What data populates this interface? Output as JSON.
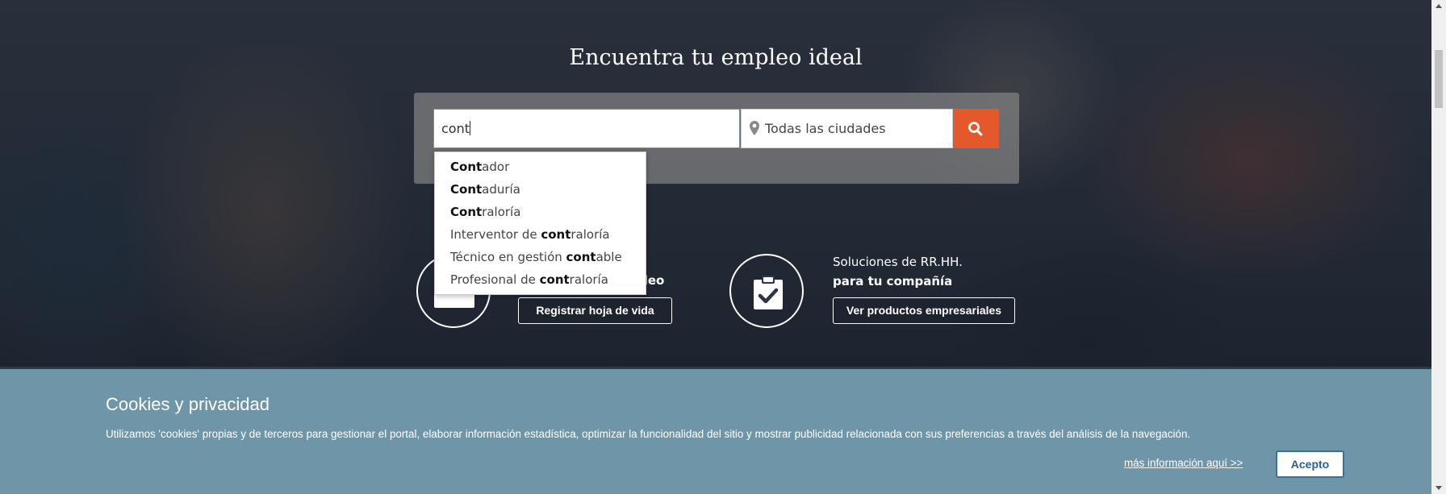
{
  "hero": {
    "title": "Encuentra tu empleo ideal"
  },
  "search": {
    "keyword_value": "cont",
    "city_value": "Todas las ciudades",
    "pin_icon": "map-pin-icon",
    "search_icon": "search-icon",
    "accent_color": "#e4582b"
  },
  "autocomplete": {
    "items": [
      {
        "pre": "",
        "match": "Cont",
        "post": "ador"
      },
      {
        "pre": "",
        "match": "Cont",
        "post": "aduría"
      },
      {
        "pre": "",
        "match": "Cont",
        "post": "raloría"
      },
      {
        "pre": "Interventor de ",
        "match": "cont",
        "post": "raloría"
      },
      {
        "pre": "Técnico en gestión ",
        "match": "cont",
        "post": "able"
      },
      {
        "pre": "Profesional de ",
        "match": "cont",
        "post": "raloría"
      }
    ]
  },
  "features": {
    "left_text_partial": "pleo",
    "left_button": "Registrar hoja de vida",
    "right_line1": "Soluciones de RR.HH.",
    "right_line2": "para tu compañía",
    "right_button": "Ver productos empresariales",
    "left_icon": "id-card-icon",
    "right_icon": "clipboard-check-icon"
  },
  "cookies": {
    "title": "Cookies y privacidad",
    "text": "Utilizamos 'cookies' propias y de terceros para gestionar el portal, elaborar información estadística, optimizar la funcionalidad del sitio y mostrar publicidad relacionada con sus preferencias a través del análisis de la navegación.",
    "more_link": "más información aquí >>",
    "accept_button": "Acepto",
    "banner_color": "#6f95a8"
  }
}
